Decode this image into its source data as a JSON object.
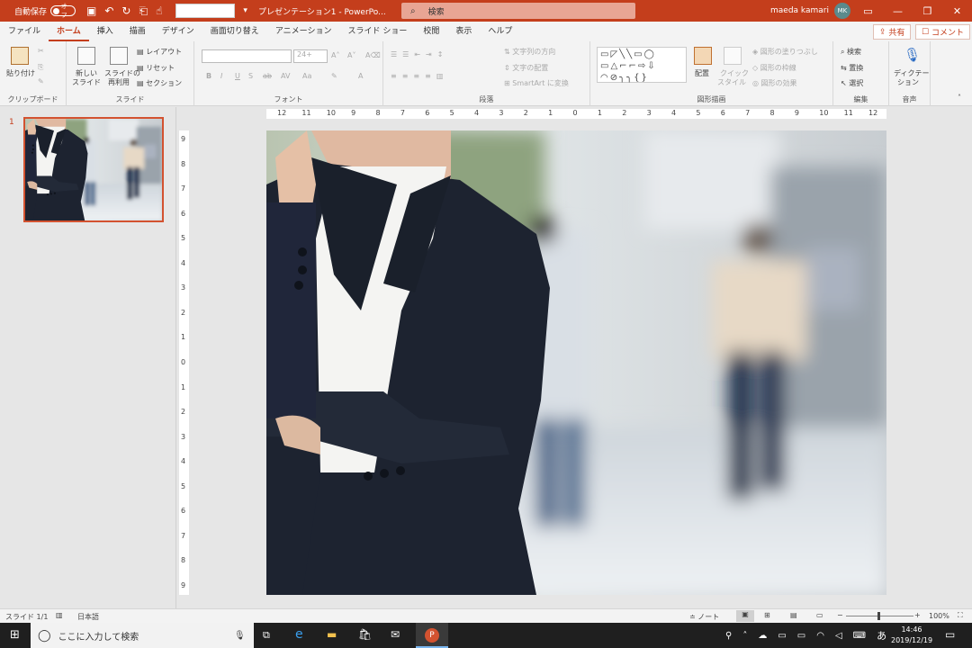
{
  "titlebar": {
    "autosave_label": "自動保存",
    "autosave_state": "オフ",
    "doc_title": "プレゼンテーション1  -  PowerPo...",
    "search_placeholder": "検索",
    "user_name": "maeda kamari",
    "user_initials": "MK",
    "share_label": "共有",
    "comment_label": "コメント"
  },
  "tabs": [
    "ファイル",
    "ホーム",
    "挿入",
    "描画",
    "デザイン",
    "画面切り替え",
    "アニメーション",
    "スライド ショー",
    "校閲",
    "表示",
    "ヘルプ"
  ],
  "active_tab": "ホーム",
  "ribbon": {
    "clipboard": {
      "label": "クリップボード",
      "paste": "貼り付け"
    },
    "slides": {
      "label": "スライド",
      "new_slide": "新しい",
      "new_slide2": "スライド",
      "reuse": "スライドの",
      "reuse2": "再利用",
      "layout": "レイアウト",
      "reset": "リセット",
      "section": "セクション"
    },
    "font": {
      "label": "フォント",
      "size": "24+",
      "bold": "B",
      "italic": "I",
      "underline": "U",
      "strike": "S",
      "shadow": "ab",
      "spacing": "AV",
      "case": "Aa"
    },
    "paragraph": {
      "label": "段落",
      "text_direction": "文字列の方向",
      "align_text": "文字の配置",
      "smartart": "SmartArt に変換"
    },
    "drawing": {
      "label": "図形描画",
      "arrange": "配置",
      "quick_styles": "クイック",
      "quick_styles2": "スタイル",
      "shape_fill": "図形の塗りつぶし",
      "shape_outline": "図形の枠線",
      "shape_effects": "図形の効果"
    },
    "editing": {
      "label": "編集",
      "find": "検索",
      "replace": "置換",
      "select": "選択"
    },
    "voice": {
      "label": "音声",
      "dictate": "ディクテー",
      "dictate2": "ション"
    }
  },
  "thumbnail": {
    "number": "1"
  },
  "ruler": {
    "h_ticks": [
      "12",
      "11",
      "10",
      "9",
      "8",
      "7",
      "6",
      "5",
      "4",
      "3",
      "2",
      "1",
      "0",
      "1",
      "2",
      "3",
      "4",
      "5",
      "6",
      "7",
      "8",
      "9",
      "10",
      "11",
      "12"
    ],
    "v_ticks": [
      "9",
      "8",
      "7",
      "6",
      "5",
      "4",
      "3",
      "2",
      "1",
      "0",
      "1",
      "2",
      "3",
      "4",
      "5",
      "6",
      "7",
      "8",
      "9"
    ]
  },
  "status": {
    "slide": "スライド 1/1",
    "language": "日本語",
    "notes": "ノート",
    "zoom": "100%"
  },
  "taskbar": {
    "search_placeholder": "ここに入力して検索",
    "time": "14:46",
    "date": "2019/12/19",
    "ime": "あ"
  },
  "colors": {
    "accent": "#c43e1c",
    "suit": "#1d2330",
    "shirt": "#f4f4f2"
  }
}
